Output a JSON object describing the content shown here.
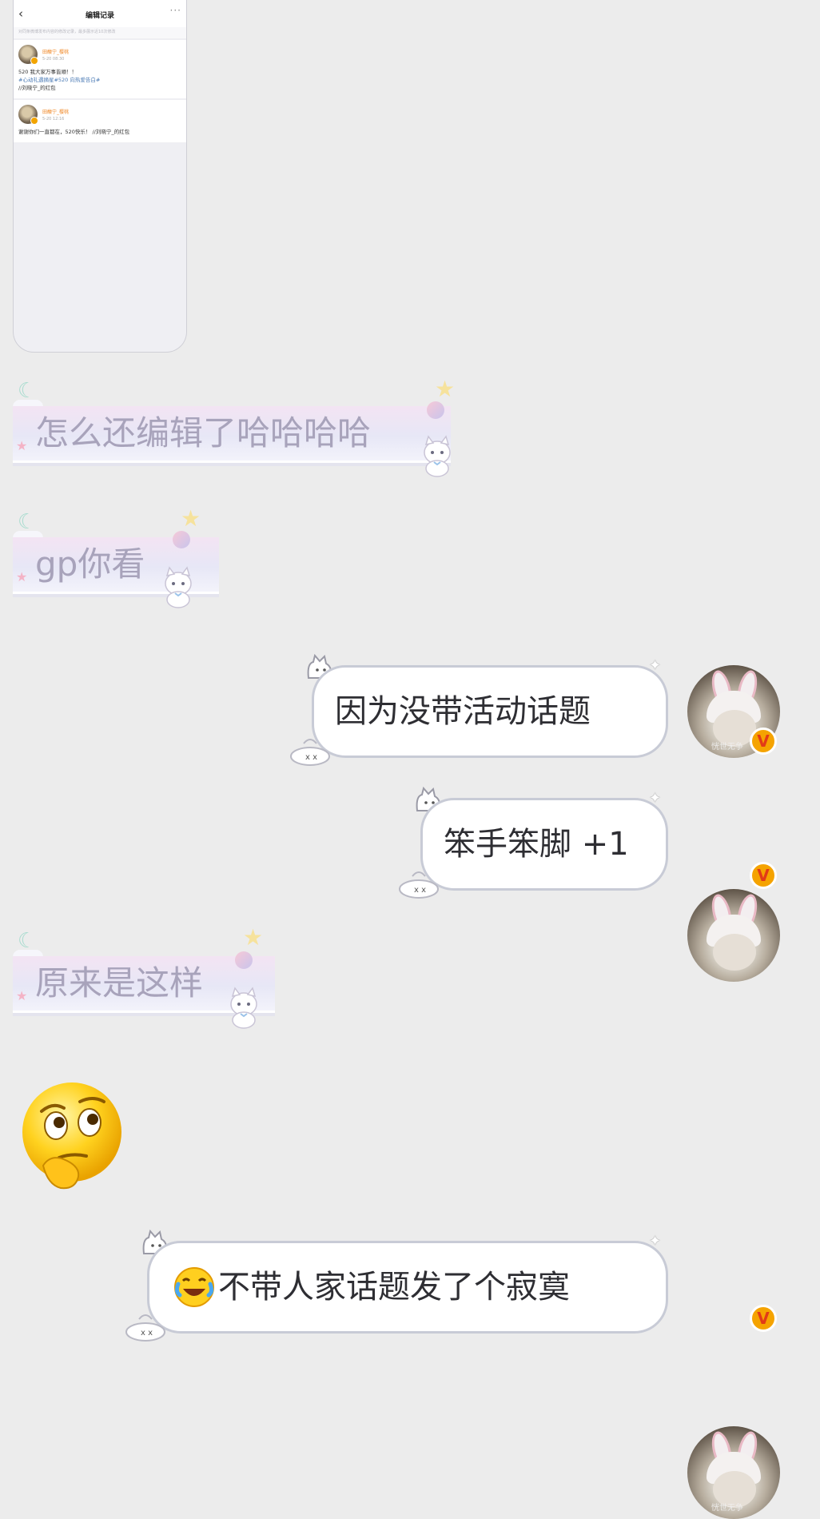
{
  "shared_screenshot": {
    "header_title": "编辑记录",
    "notice": "对同条微博发布内容的修改记录，最多展示近10次修改",
    "entries": [
      {
        "author": "田馥宁_樱桃",
        "time": "5-20 08:30",
        "lines": [
          "520 我大家万事皆顺！！",
          "#心动礼遇摘星#520 向热爱告白#",
          "//刘晓宁_的红包"
        ],
        "highlight": "#心动礼遇摘星#520 向热爱告白#"
      },
      {
        "author": "田馥宁_樱桃",
        "time": "5-20 12:16",
        "lines": [
          "谢谢你们一直都在，520快乐！ //刘晓宁_的红包"
        ]
      }
    ]
  },
  "messages": [
    {
      "id": "m1",
      "side": "received",
      "text": "怎么还编辑了哈哈哈哈"
    },
    {
      "id": "m2",
      "side": "received",
      "text": "gp你看"
    },
    {
      "id": "m3",
      "side": "sent",
      "text": "因为没带活动话题"
    },
    {
      "id": "m4",
      "side": "sent",
      "text": "笨手笨脚 +1"
    },
    {
      "id": "m5",
      "side": "received",
      "text": "原来是这样"
    },
    {
      "id": "m6",
      "side": "received",
      "type": "emoji",
      "emoji": "thinking-face"
    },
    {
      "id": "m7",
      "side": "sent",
      "text": "不带人家话题发了个寂寞",
      "leading_emoji": "laughing-crying"
    }
  ],
  "avatar": {
    "badge": "V",
    "watermark": "恍世无争"
  },
  "colors": {
    "background": "#ececec",
    "sent_bubble_border": "#c8cbd6",
    "received_text": "#a8a3bb",
    "badge_orange": "#f5a300",
    "badge_red": "#e23a17"
  }
}
